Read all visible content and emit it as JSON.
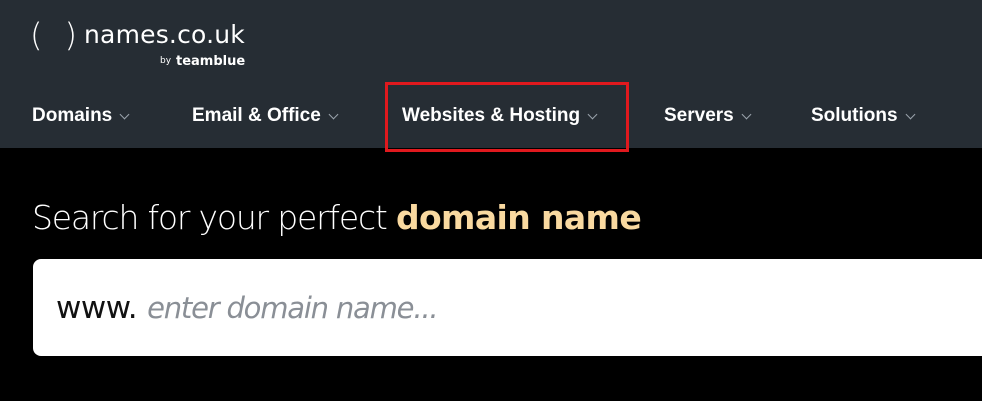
{
  "brand": {
    "name": "names.co.uk",
    "by": "by",
    "parent": "teamblue"
  },
  "nav": {
    "items": [
      {
        "label": "Domains"
      },
      {
        "label": "Email & Office"
      },
      {
        "label": "Websites & Hosting"
      },
      {
        "label": "Servers"
      },
      {
        "label": "Solutions"
      }
    ]
  },
  "hero": {
    "title_prefix": "Search for your perfect ",
    "title_accent": "domain name"
  },
  "search": {
    "prefix": "www.",
    "placeholder": "enter domain name...",
    "value": ""
  },
  "colors": {
    "header_bg": "#262d34",
    "page_bg": "#000000",
    "accent": "#f9d9a0",
    "highlight": "#e0191e"
  }
}
